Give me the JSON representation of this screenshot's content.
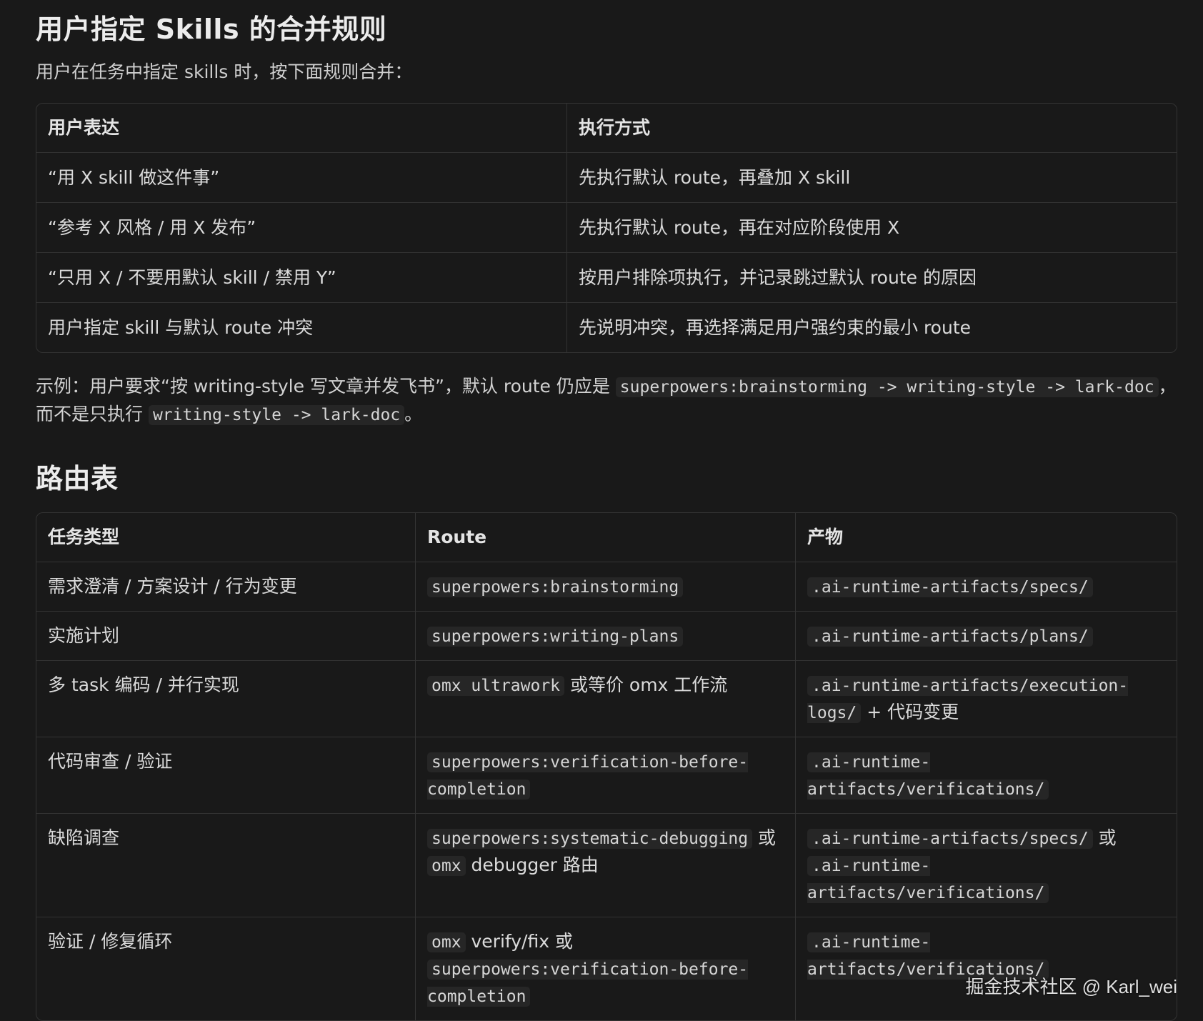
{
  "section1": {
    "title": "用户指定 Skills 的合并规则",
    "intro": "用户在任务中指定 skills 时，按下面规则合并：",
    "headers": [
      "用户表达",
      "执行方式"
    ],
    "rows": [
      [
        "“用 X skill 做这件事”",
        "先执行默认 route，再叠加 X skill"
      ],
      [
        "“参考 X 风格 / 用 X 发布”",
        "先执行默认 route，再在对应阶段使用 X"
      ],
      [
        "“只用 X / 不要用默认 skill / 禁用 Y”",
        "按用户排除项执行，并记录跳过默认 route 的原因"
      ],
      [
        "用户指定 skill 与默认 route 冲突",
        "先说明冲突，再选择满足用户强约束的最小 route"
      ]
    ],
    "example": {
      "prefix": "示例：用户要求“按 writing-style 写文章并发飞书”，默认 route 仍应是 ",
      "code1": "superpowers:brainstorming -> writing-style -> lark-doc",
      "middle": "，而不是只执行 ",
      "code2": "writing-style -> lark-doc",
      "suffix": "。"
    }
  },
  "section2": {
    "title": "路由表",
    "headers": [
      "任务类型",
      "Route",
      "产物"
    ],
    "rows": [
      {
        "task": "需求澄清 / 方案设计 / 行为变更",
        "route": [
          {
            "code": "superpowers:brainstorming"
          }
        ],
        "artifact": [
          {
            "code": ".ai-runtime-artifacts/specs/"
          }
        ]
      },
      {
        "task": "实施计划",
        "route": [
          {
            "code": "superpowers:writing-plans"
          }
        ],
        "artifact": [
          {
            "code": ".ai-runtime-artifacts/plans/"
          }
        ]
      },
      {
        "task": "多 task 编码 / 并行实现",
        "route": [
          {
            "code": "omx ultrawork"
          },
          {
            "text": " 或等价 omx 工作流"
          }
        ],
        "artifact": [
          {
            "code": ".ai-runtime-artifacts/execution-logs/"
          },
          {
            "text": " + 代码变更"
          }
        ]
      },
      {
        "task": "代码审查 / 验证",
        "route": [
          {
            "code": "superpowers:verification-before-completion"
          }
        ],
        "artifact": [
          {
            "code": ".ai-runtime-artifacts/verifications/"
          }
        ]
      },
      {
        "task": "缺陷调查",
        "route": [
          {
            "code": "superpowers:systematic-debugging"
          },
          {
            "text": " 或 "
          },
          {
            "code": "omx"
          },
          {
            "text": " debugger 路由"
          }
        ],
        "artifact": [
          {
            "code": ".ai-runtime-artifacts/specs/"
          },
          {
            "text": " 或 "
          },
          {
            "code": ".ai-runtime-artifacts/verifications/"
          }
        ]
      },
      {
        "task": "验证 / 修复循环",
        "route": [
          {
            "code": "omx"
          },
          {
            "text": " verify/fix 或 "
          },
          {
            "code": "superpowers:verification-before-completion"
          }
        ],
        "artifact": [
          {
            "code": ".ai-runtime-artifacts/verifications/"
          }
        ]
      }
    ]
  },
  "watermark": "掘金技术社区 @ Karl_wei"
}
